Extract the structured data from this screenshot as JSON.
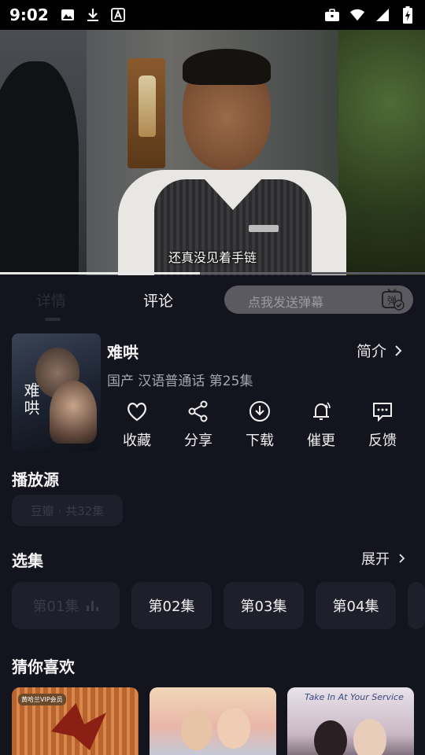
{
  "status_bar": {
    "time": "9:02",
    "icons_left": [
      "image-icon",
      "download-icon",
      "font-icon"
    ],
    "icons_right": [
      "briefcase-icon",
      "wifi-icon",
      "signal-icon",
      "battery-charging-icon"
    ]
  },
  "video": {
    "subtitle": "还真没见着手链",
    "progress": 0.47
  },
  "tabs": {
    "details": "详情",
    "comments": "评论"
  },
  "danmaku": {
    "placeholder": "点我发送弹幕",
    "icon_glyph": "弹"
  },
  "show": {
    "poster_title": "难哄",
    "title": "难哄",
    "intro_label": "简介",
    "meta": "国产 汉语普通话 第25集"
  },
  "actions": [
    {
      "label": "收藏",
      "icon": "heart-icon"
    },
    {
      "label": "分享",
      "icon": "share-icon"
    },
    {
      "label": "下载",
      "icon": "download-icon"
    },
    {
      "label": "催更",
      "icon": "bell-icon"
    },
    {
      "label": "反馈",
      "icon": "feedback-icon"
    }
  ],
  "source": {
    "title": "播放源",
    "chip": "豆瓣 · 共32集"
  },
  "episodes": {
    "title": "选集",
    "expand_label": "展开",
    "items": [
      "第01集",
      "第02集",
      "第03集",
      "第04集"
    ]
  },
  "recommend": {
    "title": "猜你喜欢",
    "card1_badge": "黄哈兰VIP会员",
    "card3_caption": "Take In At Your Service"
  },
  "colors": {
    "background": "#14141f",
    "card": "#1f1f2b",
    "muted_text": "#a5a5ad",
    "input": "#5a5a60"
  }
}
